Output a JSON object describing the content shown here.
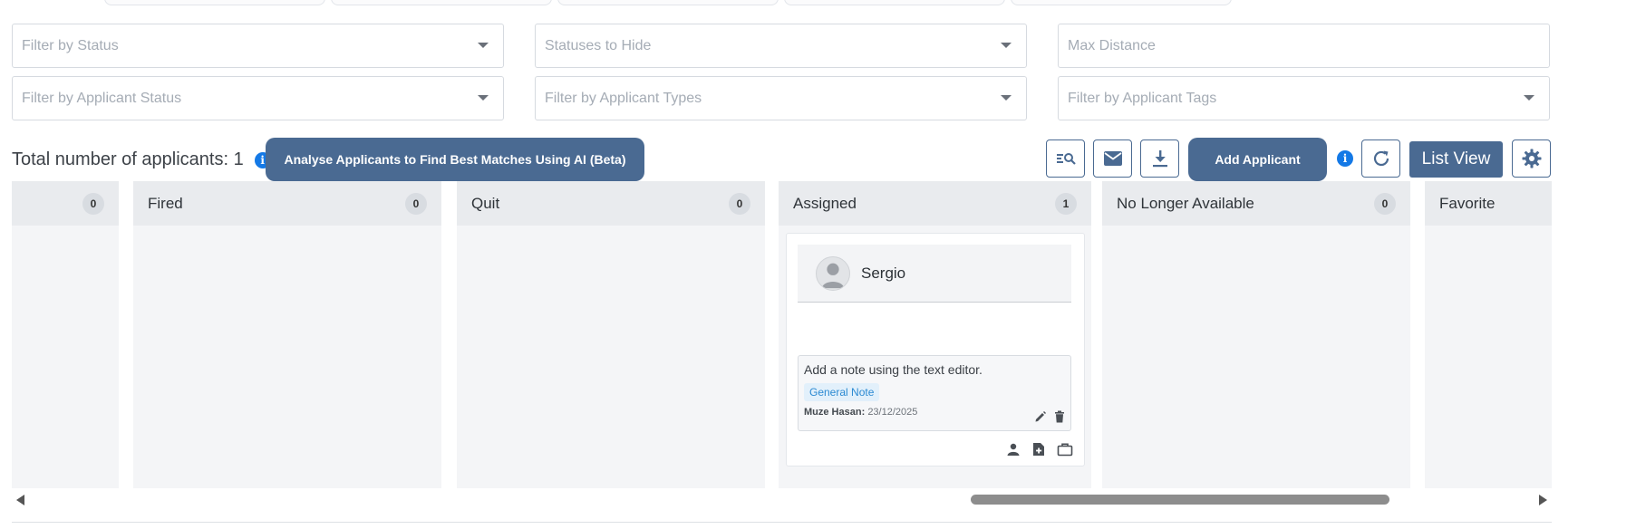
{
  "filters": {
    "status": {
      "placeholder": "Filter by Status"
    },
    "statuses_to_hide": {
      "placeholder": "Statuses to Hide"
    },
    "max_distance": {
      "placeholder": "Max Distance"
    },
    "applicant_status": {
      "placeholder": "Filter by Applicant Status"
    },
    "applicant_types": {
      "placeholder": "Filter by Applicant Types"
    },
    "applicant_tags": {
      "placeholder": "Filter by Applicant Tags"
    }
  },
  "toolbar": {
    "total_label": "Total number of applicants: 1",
    "info_glyph": "i",
    "ai_button": "Analyse Applicants to Find Best Matches Using AI (Beta)",
    "add_applicant": "Add Applicant",
    "list_view": "List View",
    "icons": [
      "search-list-icon",
      "mail-icon",
      "download-icon",
      "info-icon",
      "refresh-icon",
      "gear-icon"
    ]
  },
  "board": {
    "columns": [
      {
        "title": "",
        "count": "0"
      },
      {
        "title": "Fired",
        "count": "0"
      },
      {
        "title": "Quit",
        "count": "0"
      },
      {
        "title": "Assigned",
        "count": "1"
      },
      {
        "title": "No Longer Available",
        "count": "0"
      },
      {
        "title": "Favorite",
        "count": ""
      }
    ],
    "card": {
      "name": "Sergio",
      "note_text": "Add a note using the text editor.",
      "note_tag": "General Note",
      "note_author": "Muze Hasan:",
      "note_date": "23/12/2025"
    }
  },
  "colors": {
    "primary": "#4a6a92",
    "info": "#1479e6",
    "column_bg": "#f4f5f7",
    "column_head": "#e9ebee",
    "tag_bg": "#e2f0fb",
    "tag_text": "#2c8ad2"
  }
}
